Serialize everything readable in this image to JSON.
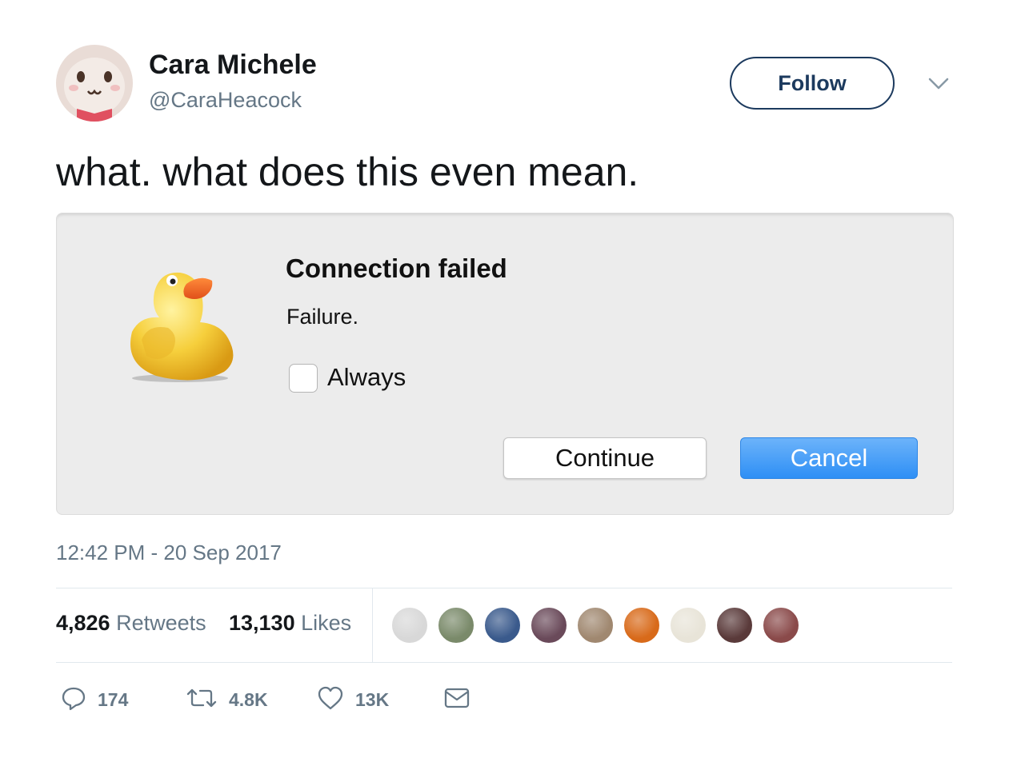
{
  "author": {
    "display_name": "Cara Michele",
    "handle": "@CaraHeacock",
    "avatar_icon": "lamb-plush-avatar",
    "follow_label": "Follow",
    "menu_icon": "chevron-down-icon"
  },
  "tweet": {
    "text": "what. what does this even mean.",
    "timestamp": "12:42 PM - 20 Sep 2017"
  },
  "dialog": {
    "app_icon": "rubber-duck-icon",
    "title": "Connection failed",
    "message": "Failure.",
    "checkbox_label": "Always",
    "checkbox_checked": false,
    "continue_label": "Continue",
    "cancel_label": "Cancel",
    "accent_color": "#2e8ff5"
  },
  "stats": {
    "retweets_count": "4,826",
    "retweets_label": "Retweets",
    "likes_count": "13,130",
    "likes_label": "Likes",
    "likers": [
      {
        "color": "#d8d8d8"
      },
      {
        "color": "#7a8a6a"
      },
      {
        "color": "#3a5a8c"
      },
      {
        "color": "#6a4a5a"
      },
      {
        "color": "#a08870"
      },
      {
        "color": "#d86a1a"
      },
      {
        "color": "#e8e4d8"
      },
      {
        "color": "#5a3a3a"
      },
      {
        "color": "#8a4a4a"
      }
    ]
  },
  "actions": {
    "replies": "174",
    "retweets": "4.8K",
    "likes": "13K",
    "reply_icon": "reply-icon",
    "retweet_icon": "retweet-icon",
    "like_icon": "heart-icon",
    "dm_icon": "envelope-icon"
  },
  "colors": {
    "text_primary": "#14171a",
    "text_secondary": "#657786",
    "follow_border": "#1c3a5e",
    "divider": "#e1e8ed"
  }
}
